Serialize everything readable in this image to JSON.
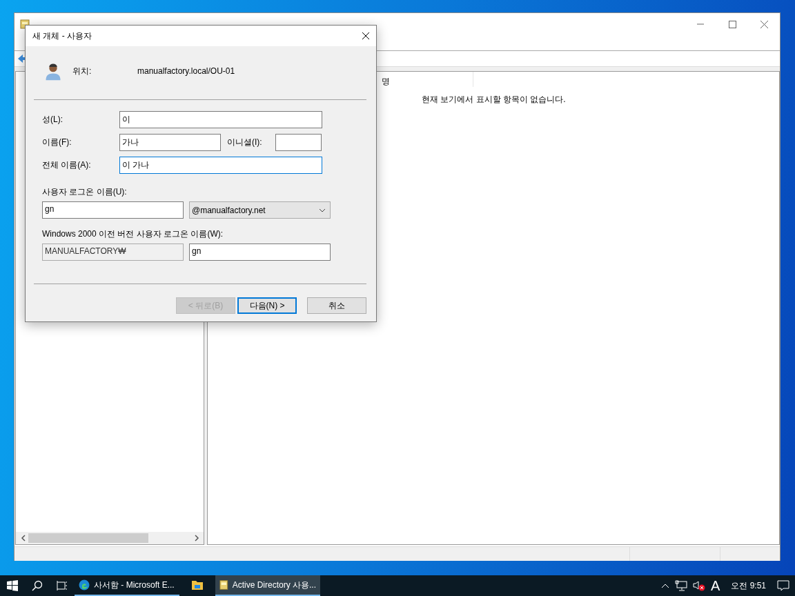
{
  "main_window": {
    "column_header": "명",
    "empty_message": "현재 보기에서 표시할 항목이 없습니다."
  },
  "dialog": {
    "title": "새 개체 - 사용자",
    "location_label": "위치:",
    "location": "manualfactory.local/OU-01",
    "last_name": {
      "label": "성(L):",
      "value": "이",
      "focused": false
    },
    "first_name": {
      "label": "이름(F):",
      "value": "가나",
      "focused": false
    },
    "initials": {
      "label": "이니셜(I):",
      "focused": false
    },
    "full_name": {
      "label": "전체 이름(A):",
      "value": "이 가나",
      "focused": true
    },
    "logon_label": "사용자 로그온 이름(U):",
    "logon_name": {
      "value": "gn",
      "focused": false
    },
    "domain": {
      "value": "@manualfactory.net"
    },
    "pre2000_label": "Windows 2000 이전 버전 사용자 로그온 이름(W):",
    "pre2000_domain": {
      "value": "MANUALFACTORY₩",
      "disabled": true
    },
    "pre2000_name": {
      "value": "gn",
      "focused": false
    },
    "buttons": [
      {
        "label": "< 뒤로(B)",
        "disabled": true,
        "default": false
      },
      {
        "label": "다음(N) >",
        "disabled": false,
        "default": true
      },
      {
        "label": "취소",
        "disabled": false,
        "default": false
      }
    ]
  },
  "taskbar": {
    "apps": [
      {
        "kind": "edge",
        "label": "사서함 - Microsoft E...",
        "selected": false
      },
      {
        "kind": "explorer",
        "selected": false
      },
      {
        "kind": "ad",
        "label": "Active Directory 사용...",
        "selected": true
      }
    ],
    "ime": "A",
    "clock": "오전 9:51"
  }
}
